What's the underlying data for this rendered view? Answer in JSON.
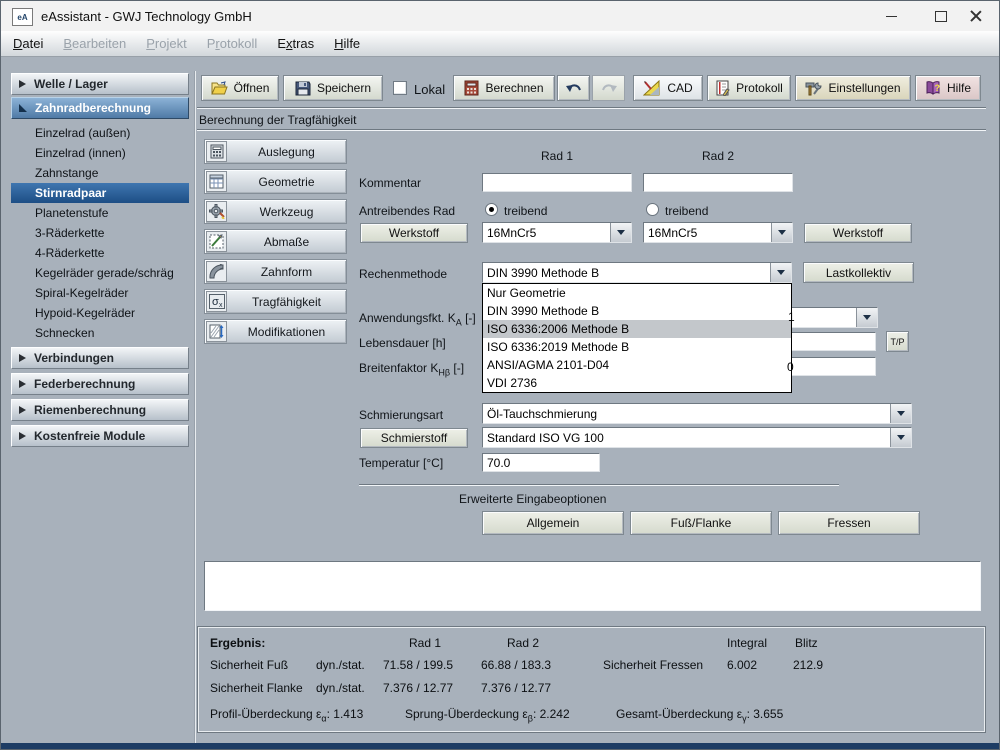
{
  "window": {
    "title": "eAssistant - GWJ Technology GmbH",
    "app_icon_text": "eA"
  },
  "menu": {
    "items": [
      {
        "pre": "",
        "u": "D",
        "post": "atei"
      },
      {
        "pre": "",
        "u": "B",
        "post": "earbeiten"
      },
      {
        "pre": "",
        "u": "P",
        "post": "rojekt"
      },
      {
        "pre": "P",
        "u": "r",
        "post": "otokoll"
      },
      {
        "pre": "E",
        "u": "x",
        "post": "tras"
      },
      {
        "pre": "",
        "u": "H",
        "post": "ilfe"
      }
    ]
  },
  "toolbar": {
    "open": "Öffnen",
    "save": "Speichern",
    "local": "Lokal",
    "calculate": "Berechnen",
    "cad": "CAD",
    "protocol": "Protokoll",
    "settings": "Einstellungen",
    "help": "Hilfe"
  },
  "sidebar": {
    "sections": [
      {
        "label": "Welle / Lager"
      },
      {
        "label": "Zahnradberechnung",
        "selected": "Stirnradpaar",
        "items": [
          "Einzelrad (außen)",
          "Einzelrad (innen)",
          "Zahnstange",
          "Stirnradpaar",
          "Planetenstufe",
          "3-Räderkette",
          "4-Räderkette",
          "Kegelräder gerade/schräg",
          "Spiral-Kegelräder",
          "Hypoid-Kegelräder",
          "Schnecken"
        ]
      },
      {
        "label": "Verbindungen"
      },
      {
        "label": "Federberechnung"
      },
      {
        "label": "Riemenberechnung"
      },
      {
        "label": "Kostenfreie Module"
      }
    ]
  },
  "main": {
    "section_title": "Berechnung der Tragfähigkeit",
    "nav_buttons": [
      "Auslegung",
      "Geometrie",
      "Werkzeug",
      "Abmaße",
      "Zahnform",
      "Tragfähigkeit",
      "Modifikationen"
    ],
    "form": {
      "col1_header": "Rad 1",
      "col2_header": "Rad 2",
      "kommentar_label": "Kommentar",
      "kommentar1": "",
      "kommentar2": "",
      "antreibend_label": "Antreibendes Rad",
      "treibend1": "treibend",
      "treibend2": "treibend",
      "werkstoff_button": "Werkstoff",
      "material1": "16MnCr5",
      "material2": "16MnCr5",
      "rechenmethode_label": "Rechenmethode",
      "rechenmethode_value": "DIN 3990 Methode B",
      "lastkollektiv_button": "Lastkollektiv",
      "ka_label_pre": "Anwendungsfkt. K",
      "ka_label_sub": "A",
      "ka_label_post": " [-]",
      "ka_visible_fragment": "1",
      "lebensdauer_label": "Lebensdauer [h]",
      "tp_sup": "T",
      "tp_slash": "/",
      "tp_sub": "P",
      "khb_label_pre": "Breitenfaktor K",
      "khb_label_sub": "Hβ",
      "khb_label_post": " [-]",
      "khb_visible_fragment": "0",
      "schmierungsart_label": "Schmierungsart",
      "schmierungsart_value": "Öl-Tauchschmierung",
      "schmierstoff_button": "Schmierstoff",
      "schmierstoff_value": "Standard ISO VG 100",
      "temperatur_label": "Temperatur [°C]",
      "temperatur_value": "70.0"
    },
    "dropdown": {
      "options": [
        "Nur Geometrie",
        "DIN 3990 Methode B",
        "ISO 6336:2006 Methode B",
        "ISO 6336:2019 Methode B",
        "ANSI/AGMA 2101-D04",
        "VDI 2736"
      ],
      "highlighted": "ISO 6336:2006 Methode B"
    },
    "advanced": {
      "title": "Erweiterte Eingabeoptionen",
      "buttons": [
        "Allgemein",
        "Fuß/Flanke",
        "Fressen"
      ]
    },
    "results": {
      "title": "Ergebnis:",
      "headers": {
        "rad1": "Rad 1",
        "rad2": "Rad 2",
        "integral": "Integral",
        "blitz": "Blitz"
      },
      "fuss": {
        "label": "Sicherheit Fuß",
        "mode": "dyn./stat.",
        "rad1": "71.58 / 199.5",
        "rad2": "66.88 / 183.3"
      },
      "flanke": {
        "label": "Sicherheit Flanke",
        "mode": "dyn./stat.",
        "rad1": "7.376 / 12.77",
        "rad2": "7.376 / 12.77"
      },
      "fressen": {
        "label": "Sicherheit Fressen",
        "integral": "6.002",
        "blitz": "212.9"
      },
      "overlap": {
        "profil_pre": "Profil-Überdeckung ε",
        "profil_sub": "α",
        "profil_val": ": 1.413",
        "sprung_pre": "Sprung-Überdeckung ε",
        "sprung_sub": "β",
        "sprung_val": ": 2.242",
        "gesamt_pre": "Gesamt-Überdeckung ε",
        "gesamt_sub": "γ",
        "gesamt_val": ": 3.655"
      }
    }
  }
}
